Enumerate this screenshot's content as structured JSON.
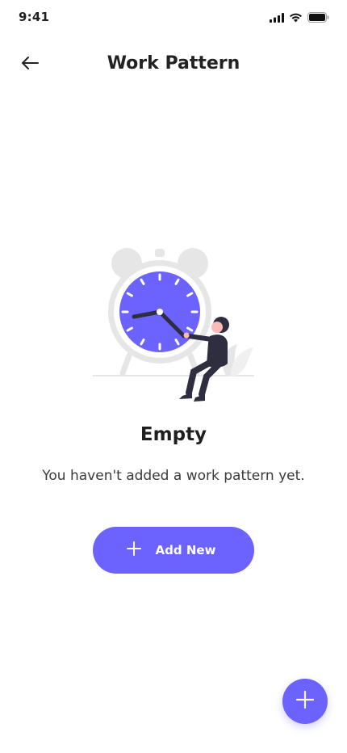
{
  "status_bar": {
    "time": "9:41",
    "icons": [
      "signal-icon",
      "wifi-icon",
      "battery-icon"
    ]
  },
  "header": {
    "title": "Work Pattern",
    "back_icon": "arrow-left-icon"
  },
  "empty_state": {
    "title": "Empty",
    "message": "You haven't added a work pattern yet.",
    "illustration": "alarm-clock-illustration"
  },
  "actions": {
    "add_new_label": "Add New",
    "add_new_icon": "plus-icon",
    "fab_icon": "plus-icon"
  },
  "colors": {
    "accent": "#6C63FF",
    "text_primary": "#1f1f1f",
    "text_secondary": "#3a3a3a",
    "background": "#ffffff"
  }
}
